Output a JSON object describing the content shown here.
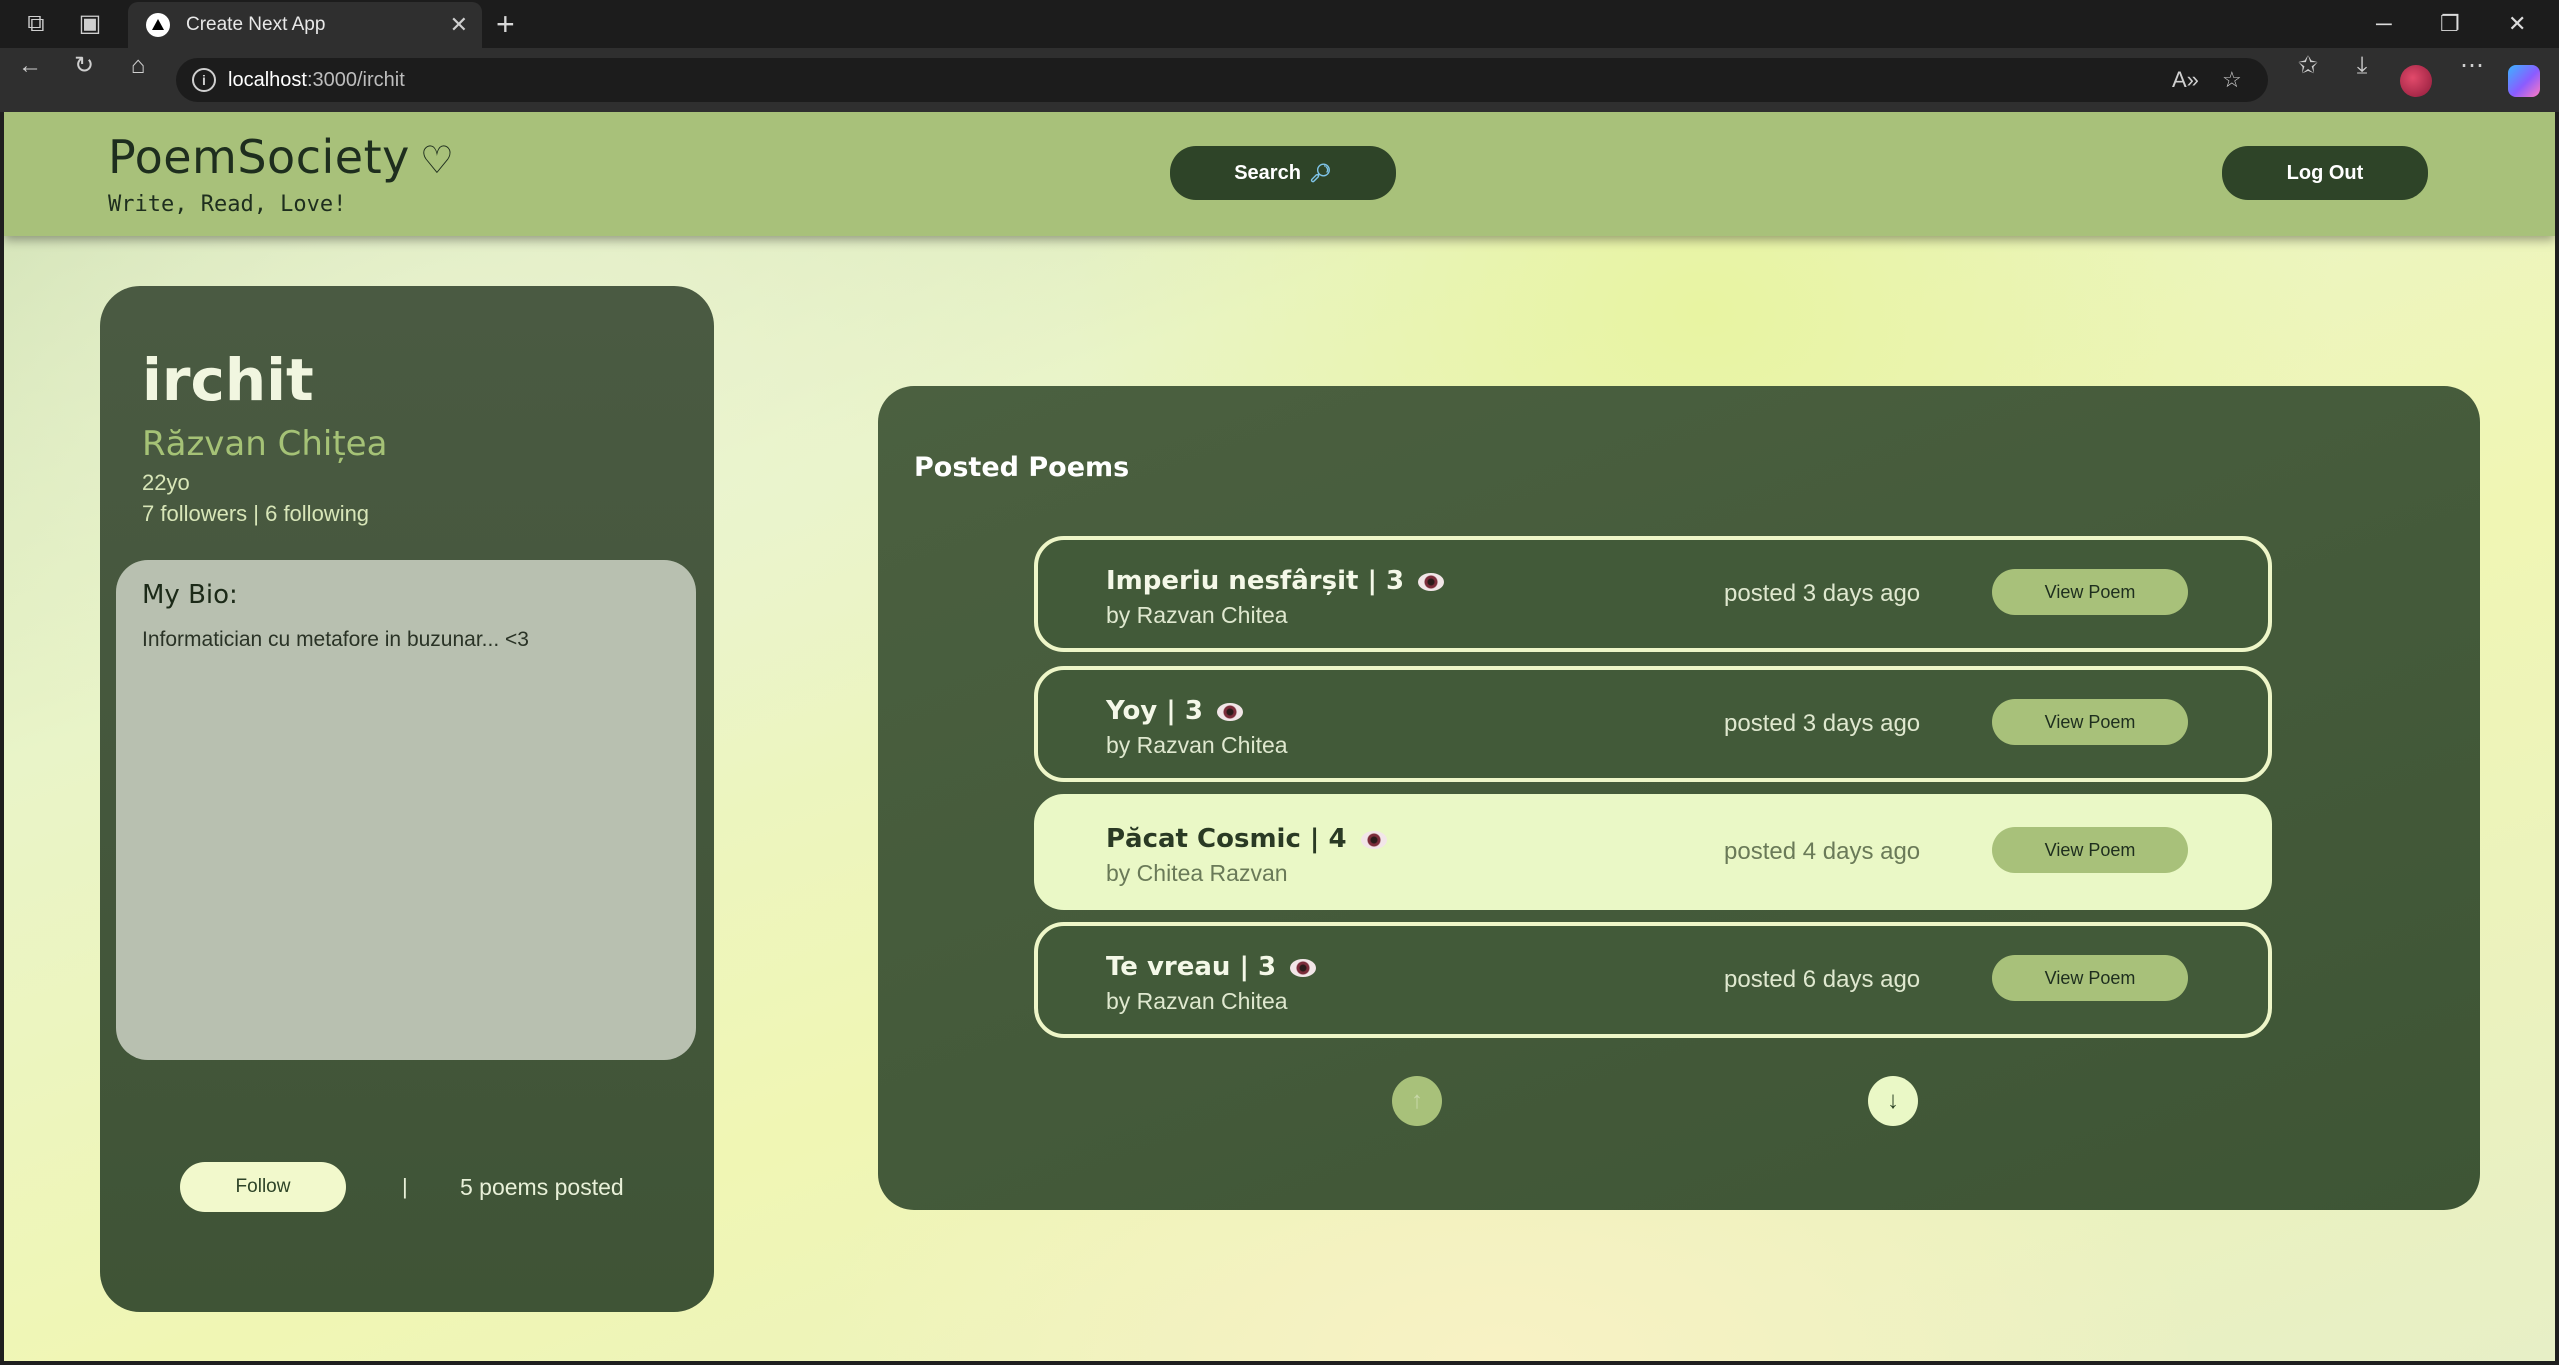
{
  "browser": {
    "tab_title": "Create Next App",
    "url_host": "localhost",
    "url_path": ":3000/irchit"
  },
  "header": {
    "brand": "PoemSociety",
    "brand_heart": "♡",
    "tagline": "Write, Read, Love!",
    "search_label": "Search",
    "logout_label": "Log Out"
  },
  "profile": {
    "username": "irchit",
    "full_name": "Răzvan Chițea",
    "age": "22yo",
    "follow_stats": "7 followers | 6 following",
    "bio_title": "My Bio:",
    "bio_text": "Informatician cu metafore in buzunar... <3",
    "follow_label": "Follow",
    "separator": "|",
    "poems_count": "5 poems posted"
  },
  "poems_panel": {
    "title": "Posted Poems",
    "view_label": "View Poem",
    "items": [
      {
        "title": "Imperiu nesfârșit | 3",
        "author": "by Razvan Chitea",
        "posted": "posted 3 days ago"
      },
      {
        "title": "Yoy | 3",
        "author": "by Razvan Chitea",
        "posted": "posted 3 days ago"
      },
      {
        "title": "Păcat Cosmic | 4",
        "author": "by Chitea Razvan",
        "posted": "posted 4 days ago"
      },
      {
        "title": "Te vreau | 3",
        "author": "by Razvan Chitea",
        "posted": "posted 6 days ago"
      }
    ],
    "prev_arrow": "↑",
    "next_arrow": "↓"
  },
  "colors": {
    "header_bg": "#a8c17a",
    "card_dark": "#3f5436",
    "button_dark": "#2e4428",
    "accent_light": "#eaf8c6"
  }
}
